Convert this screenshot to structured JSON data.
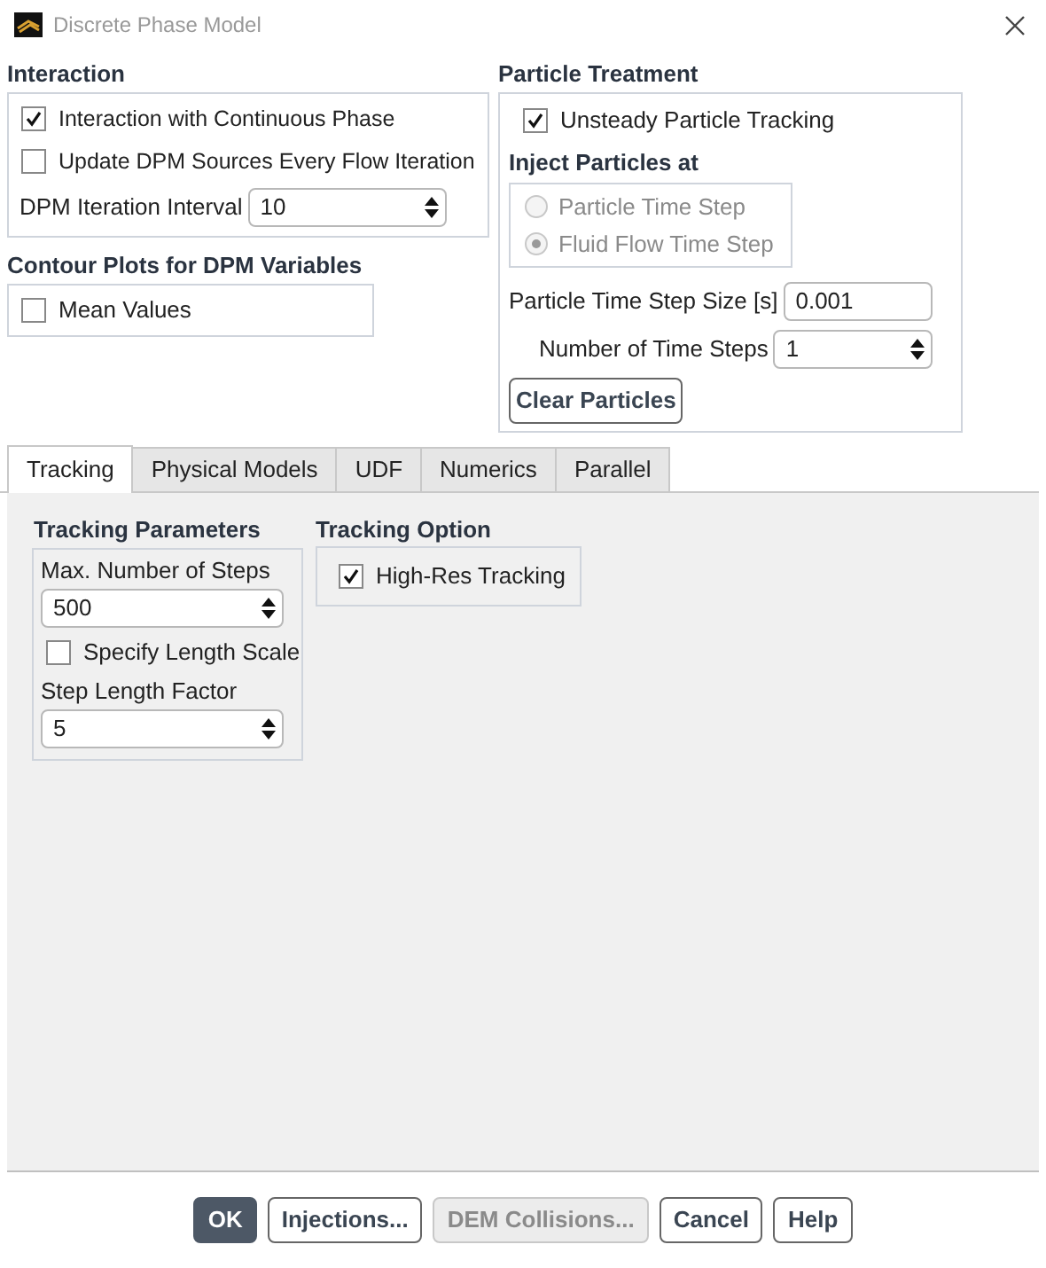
{
  "window": {
    "title": "Discrete Phase Model"
  },
  "interaction": {
    "title": "Interaction",
    "options": [
      {
        "label": "Interaction with Continuous Phase",
        "checked": true
      },
      {
        "label": "Update DPM Sources Every Flow Iteration",
        "checked": false
      }
    ],
    "iteration_interval": {
      "label": "DPM Iteration Interval",
      "value": "10"
    }
  },
  "contour_plots": {
    "title": "Contour Plots for DPM Variables",
    "options": [
      {
        "label": "Mean Values",
        "checked": false
      }
    ]
  },
  "particle_treatment": {
    "title": "Particle Treatment",
    "unsteady": {
      "label": "Unsteady Particle Tracking",
      "checked": true
    },
    "inject": {
      "title": "Inject Particles at",
      "disabled": true,
      "options": [
        {
          "label": "Particle Time Step",
          "selected": false
        },
        {
          "label": "Fluid Flow Time Step",
          "selected": true
        }
      ]
    },
    "time_step_size": {
      "label": "Particle Time Step Size [s]",
      "value": "0.001"
    },
    "number_of_time_steps": {
      "label": "Number of Time Steps",
      "value": "1"
    },
    "clear_button": "Clear Particles"
  },
  "tabs": [
    {
      "label": "Tracking",
      "selected": true
    },
    {
      "label": "Physical Models",
      "selected": false
    },
    {
      "label": "UDF",
      "selected": false
    },
    {
      "label": "Numerics",
      "selected": false
    },
    {
      "label": "Parallel",
      "selected": false
    }
  ],
  "tracking_parameters": {
    "title": "Tracking Parameters",
    "max_steps": {
      "label": "Max. Number of Steps",
      "value": "500"
    },
    "specify_length_scale": {
      "label": "Specify Length Scale",
      "checked": false
    },
    "step_length_factor": {
      "label": "Step Length Factor",
      "value": "5"
    }
  },
  "tracking_option": {
    "title": "Tracking Option",
    "options": [
      {
        "label": "High-Res Tracking",
        "checked": true
      }
    ]
  },
  "buttons": [
    {
      "label": "OK",
      "kind": "primary"
    },
    {
      "label": "Injections...",
      "kind": "normal"
    },
    {
      "label": "DEM Collisions...",
      "kind": "disabled"
    },
    {
      "label": "Cancel",
      "kind": "normal"
    },
    {
      "label": "Help",
      "kind": "normal"
    }
  ]
}
